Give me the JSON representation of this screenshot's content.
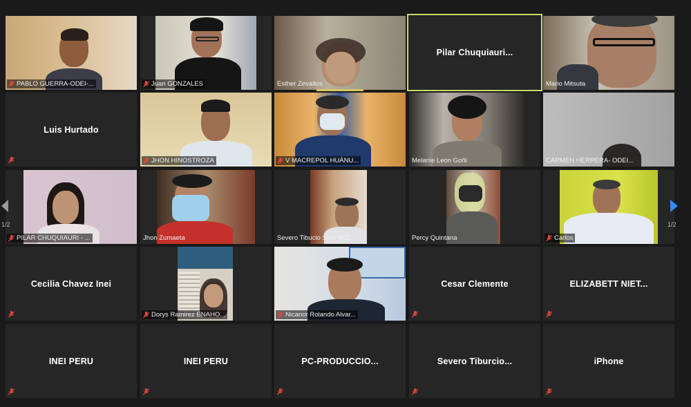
{
  "meeting": {
    "page_indicator_left": "1/2",
    "page_indicator_right": "1/2"
  },
  "tiles": [
    {
      "name": "PABLO GUERRA-ODEI-...",
      "video": true
    },
    {
      "name": "Juan GONZALES",
      "video": true
    },
    {
      "name": "Esther Zevallos",
      "video": true
    },
    {
      "name": "Pilar  Chuquiauri...",
      "video": false,
      "active": true
    },
    {
      "name": "Mario Mitsuta",
      "video": true
    },
    {
      "name": "Luis Hurtado",
      "video": false
    },
    {
      "name": "JHON HINOSTROZA",
      "video": true
    },
    {
      "name": "V MACREPOL HUÁNU...",
      "video": true
    },
    {
      "name": "Melanie Leon Goñi",
      "video": true
    },
    {
      "name": "CARMEN HERRERA- ODEI...",
      "video": true
    },
    {
      "name": "PILAR CHUQUIAURI - ...",
      "video": true
    },
    {
      "name": "Jhon Zumaeta",
      "video": true
    },
    {
      "name": "Severo Tibucio Soto MCL...",
      "video": true
    },
    {
      "name": "Percy Quintana",
      "video": true
    },
    {
      "name": "Carlos",
      "video": true
    },
    {
      "name": "Cecilia Chavez Inei",
      "video": false
    },
    {
      "name": "Dorys Ramirez ENAHO...",
      "video": true
    },
    {
      "name": "Nicanor Rolando Alvar...",
      "video": true
    },
    {
      "name": "Cesar Clemente",
      "video": false
    },
    {
      "name": "ELIZABETT  NIET...",
      "video": false
    },
    {
      "name": "INEI PERU",
      "video": false
    },
    {
      "name": "INEI PERU",
      "video": false
    },
    {
      "name": "PC-PRODUCCIO...",
      "video": false
    },
    {
      "name": "Severo  Tiburcio...",
      "video": false
    },
    {
      "name": "iPhone",
      "video": false
    }
  ],
  "colors": {
    "background": "#1a1a1a",
    "tile": "#262626",
    "active_border": "#c6dc6a",
    "muted_mic": "#e0463c",
    "next_arrow": "#2d8cff"
  }
}
